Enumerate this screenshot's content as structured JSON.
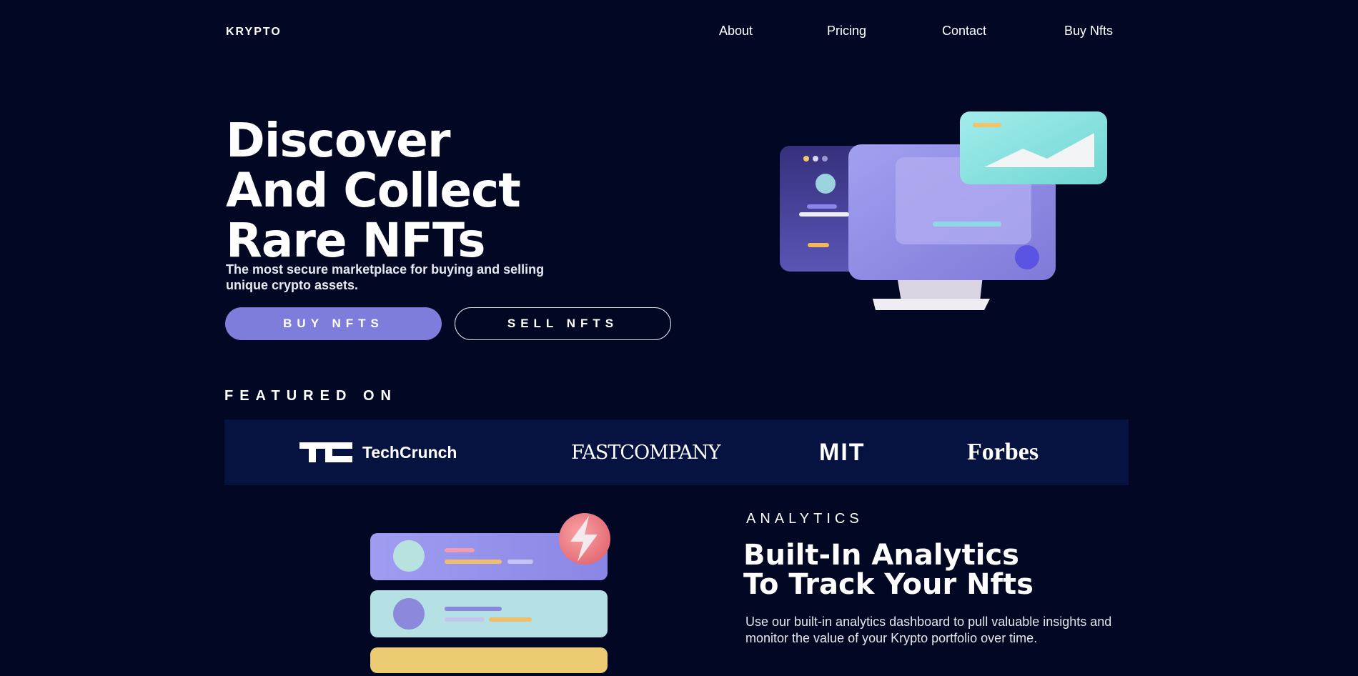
{
  "app": {
    "logo": "KRYPTO"
  },
  "nav": {
    "items": [
      "About",
      "Pricing",
      "Contact",
      "Buy Nfts"
    ]
  },
  "hero": {
    "title_lines": [
      "Discover",
      "And Collect",
      "Rare NFTs"
    ],
    "subtitle": "The most secure marketplace for buying and selling unique crypto assets.",
    "buy_label": "BUY NFTS",
    "sell_label": "SELL NFTS"
  },
  "featured": {
    "label": "FEATURED ON",
    "brands": [
      "TechCrunch",
      "FASTCOMPANY",
      "MIT",
      "Forbes"
    ]
  },
  "analytics": {
    "label": "ANALYTICS",
    "title_lines": [
      "Built-In Analytics",
      "To Track Your Nfts"
    ],
    "description": "Use our built-in analytics dashboard to pull valuable insights and monitor the value of your Krypto portfolio over time."
  },
  "colors": {
    "background": "#020824",
    "accent": "#7f7ddc",
    "band": "#061240"
  }
}
